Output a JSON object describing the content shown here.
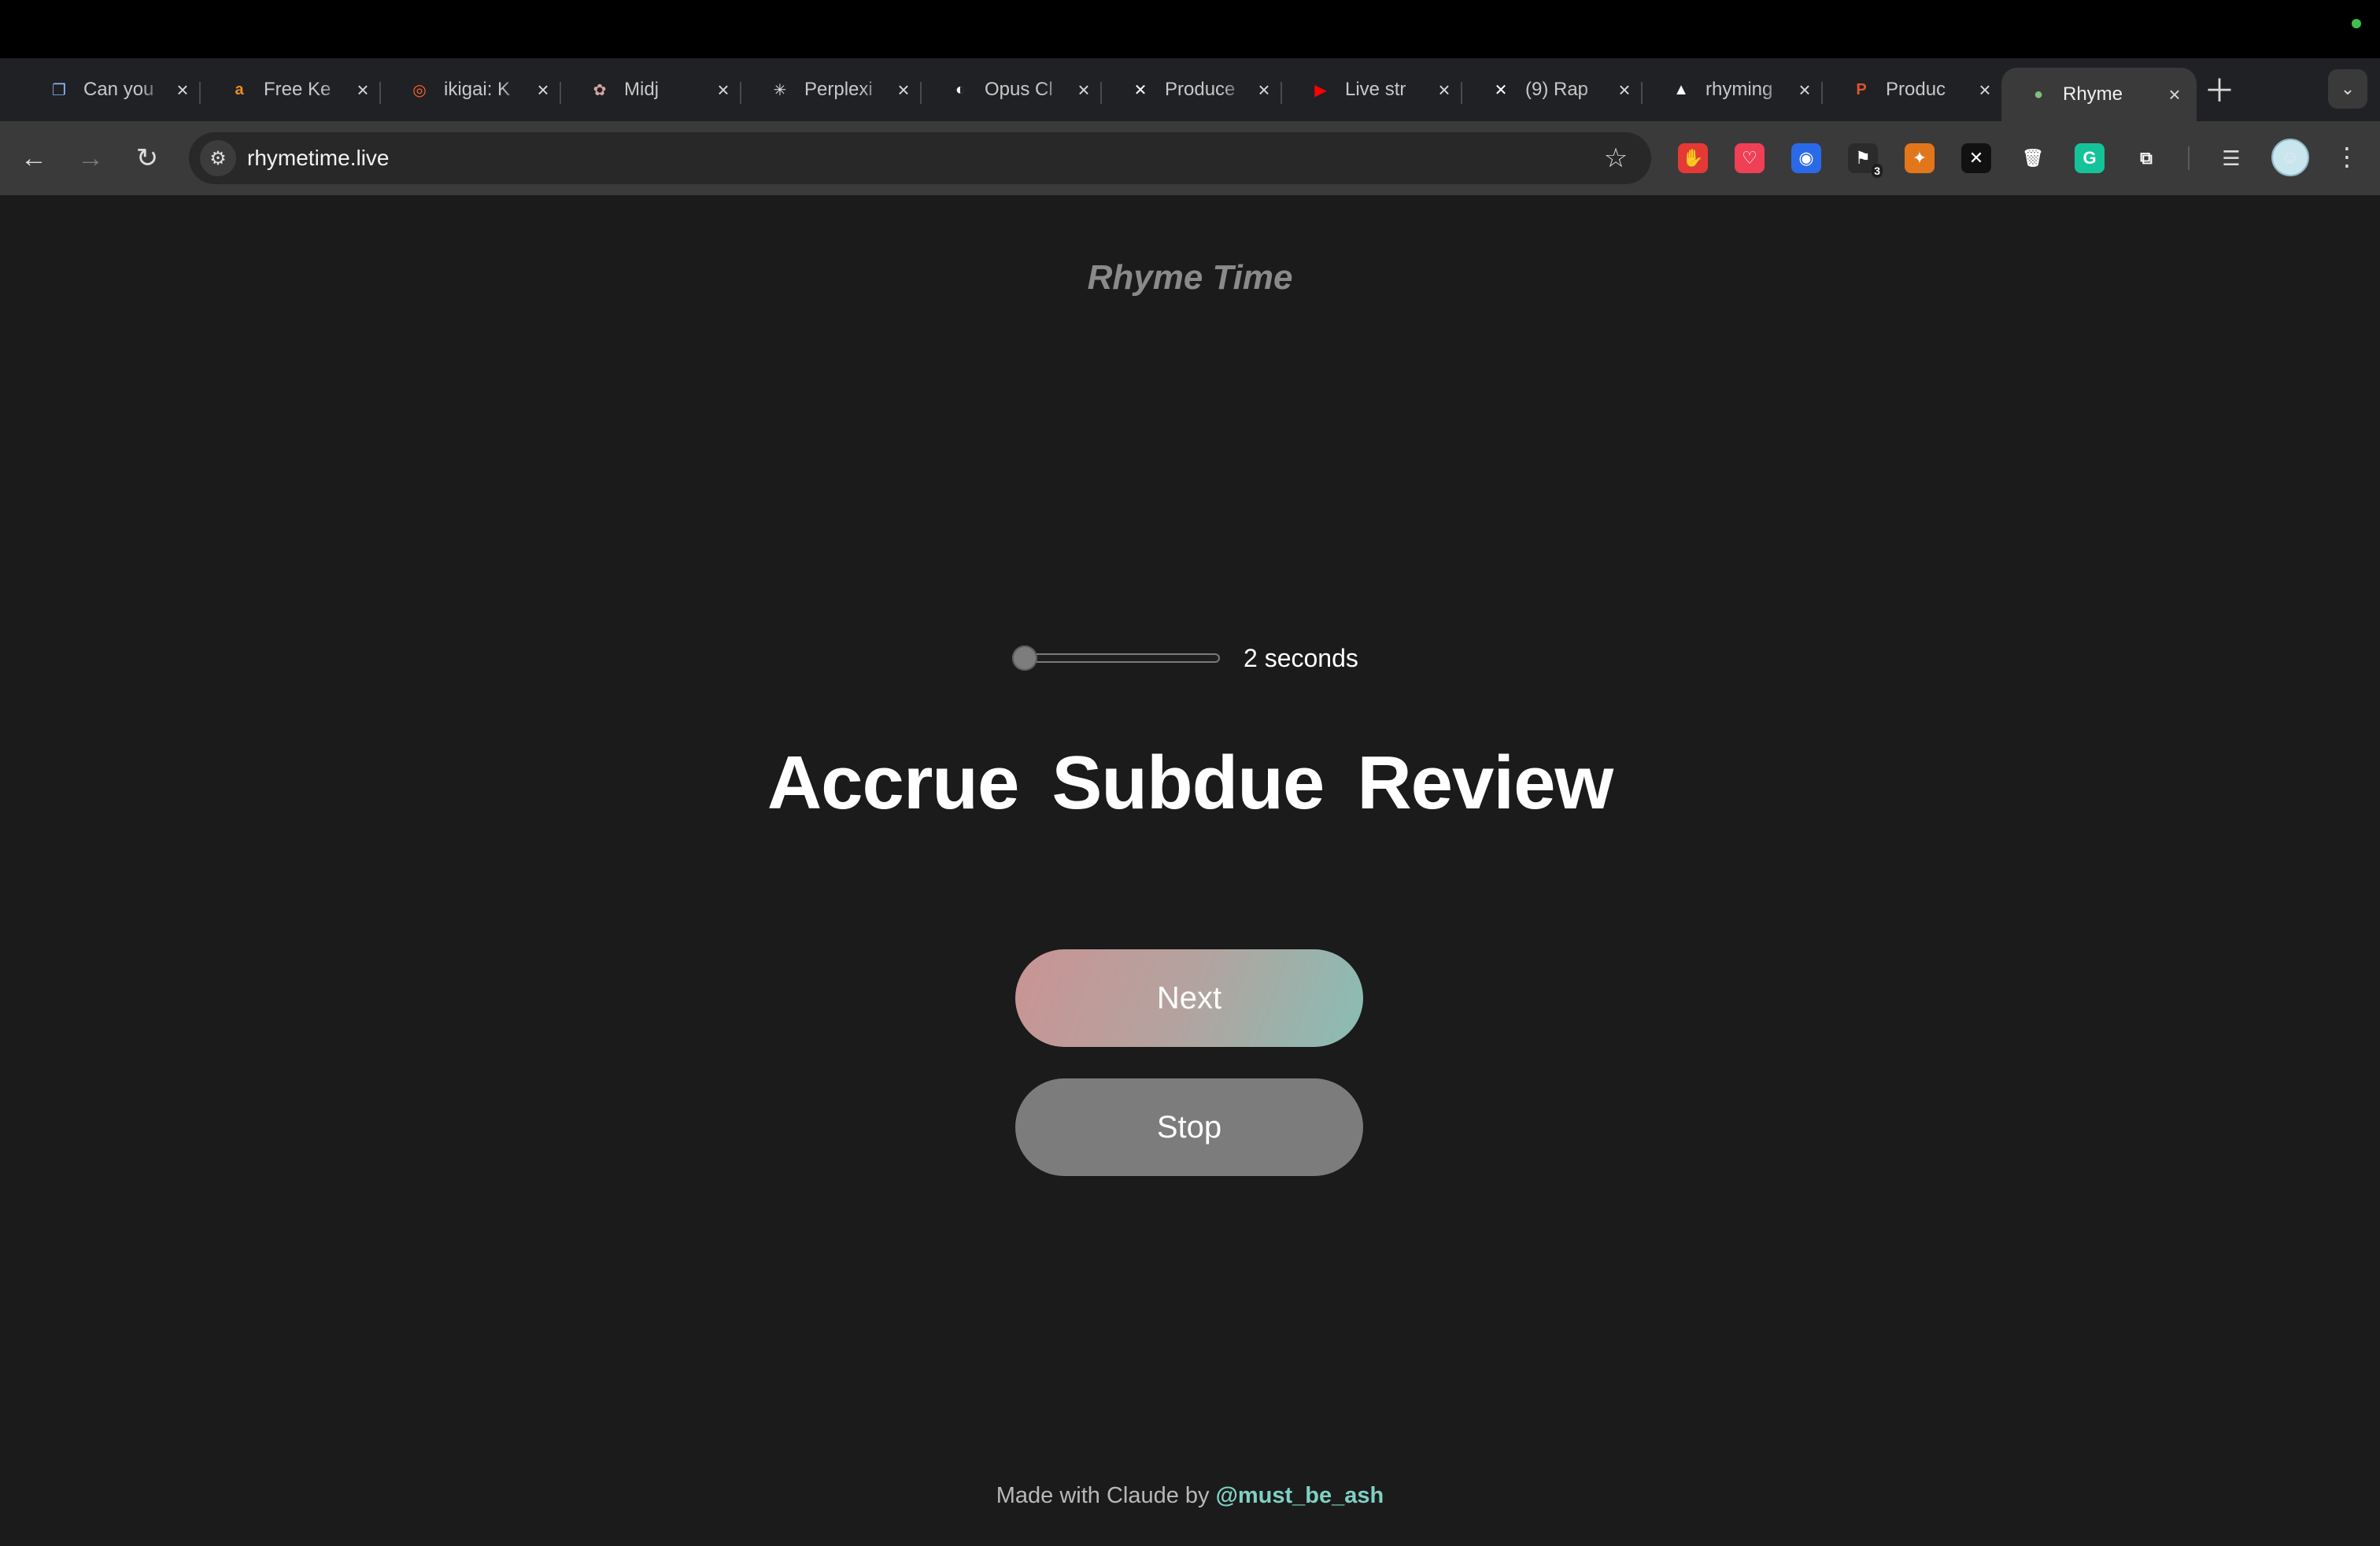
{
  "colors": {
    "page_bg": "#1b1b1b",
    "status_dot": "#3fbf4f",
    "author_link": "#7fd1c3"
  },
  "browser": {
    "tabs": [
      {
        "label": "Can you",
        "icon": "docs-icon",
        "color": "#8ab4f8",
        "glyph": "❐"
      },
      {
        "label": "Free Ke",
        "icon": "amazon-icon",
        "color": "#f08a24",
        "glyph": "a"
      },
      {
        "label": "ikigai: K",
        "icon": "semrush-icon",
        "color": "#ff642d",
        "glyph": "◎"
      },
      {
        "label": "Midj",
        "icon": "midjourney-icon",
        "color": "#d7a5a5",
        "glyph": "✿"
      },
      {
        "label": "Perplexi",
        "icon": "perplexity-icon",
        "color": "#e0e0e0",
        "glyph": "✳"
      },
      {
        "label": "Opus Cl",
        "icon": "opus-icon",
        "color": "#ffffff",
        "glyph": "◐"
      },
      {
        "label": "Produce",
        "icon": "x-icon",
        "color": "#ffffff",
        "glyph": "✕"
      },
      {
        "label": "Live str",
        "icon": "youtube-icon",
        "color": "#ff0000",
        "glyph": "▶"
      },
      {
        "label": "(9) Rap",
        "icon": "x-icon",
        "color": "#ffffff",
        "glyph": "✕"
      },
      {
        "label": "rhyming",
        "icon": "vercel-icon",
        "color": "#ffffff",
        "glyph": "▲"
      },
      {
        "label": "Produc",
        "icon": "producthunt-icon",
        "color": "#da552f",
        "glyph": "P"
      },
      {
        "label": "Rhyme",
        "icon": "site-icon",
        "color": "#7fbf7f",
        "glyph": "●",
        "active": true
      }
    ],
    "url": "rhymetime.live",
    "extensions": [
      {
        "icon": "adblock-icon",
        "color": "#e53935",
        "glyph": "✋"
      },
      {
        "icon": "pocket-icon",
        "color": "#ef4056",
        "glyph": "♡"
      },
      {
        "icon": "onepassword-icon",
        "color": "#2a6ae8",
        "glyph": "◉"
      },
      {
        "icon": "extension-badge-icon",
        "color": "#2b2b2b",
        "glyph": "⚑",
        "badge": "3"
      },
      {
        "icon": "metamask-icon",
        "color": "#e2761b",
        "glyph": "✦"
      },
      {
        "icon": "x-ext-icon",
        "color": "#111111",
        "glyph": "✕"
      },
      {
        "icon": "trash-icon",
        "color": "#3a3a3a",
        "glyph": "🗑"
      },
      {
        "icon": "grammarly-icon",
        "color": "#15c39a",
        "glyph": "G"
      },
      {
        "icon": "puzzle-icon",
        "color": "#3a3a3a",
        "glyph": "⧉"
      }
    ]
  },
  "page": {
    "title": "Rhyme Time",
    "slider": {
      "min": 2,
      "max": 10,
      "value": 2,
      "label": "2 seconds"
    },
    "words": [
      "Accrue",
      "Subdue",
      "Review"
    ],
    "next_label": "Next",
    "stop_label": "Stop",
    "footer_prefix": "Made with Claude by ",
    "footer_author": "@must_be_ash"
  }
}
